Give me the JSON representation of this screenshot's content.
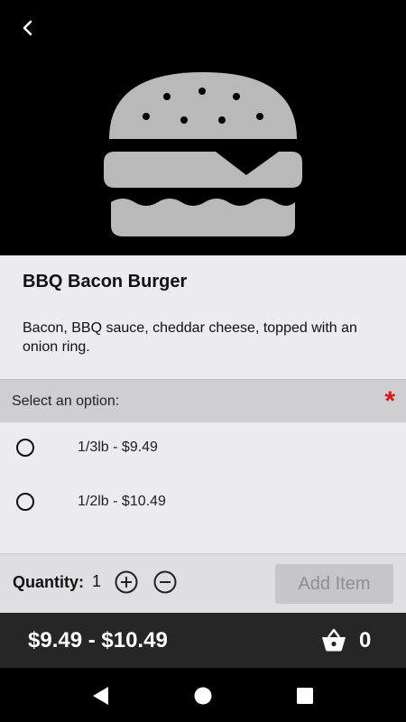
{
  "item": {
    "title": "BBQ Bacon Burger",
    "description": "Bacon, BBQ sauce, cheddar cheese, topped with an onion ring.",
    "image_icon": "burger-icon"
  },
  "options": {
    "header": "Select an option:",
    "required_mark": "*",
    "items": [
      {
        "label": "1/3lb - $9.49",
        "selected": false
      },
      {
        "label": "1/2lb - $10.49",
        "selected": false
      }
    ]
  },
  "quantity": {
    "label": "Quantity:",
    "value": "1",
    "increase_icon": "plus-circle-icon",
    "decrease_icon": "minus-circle-icon"
  },
  "add_button": {
    "label": "Add Item",
    "disabled": true
  },
  "footer": {
    "price_range": "$9.49 - $10.49",
    "basket_icon": "basket-icon",
    "basket_count": "0"
  },
  "colors": {
    "required": "#e01515",
    "footer_bg": "#262626",
    "image_bg": "#000000"
  }
}
